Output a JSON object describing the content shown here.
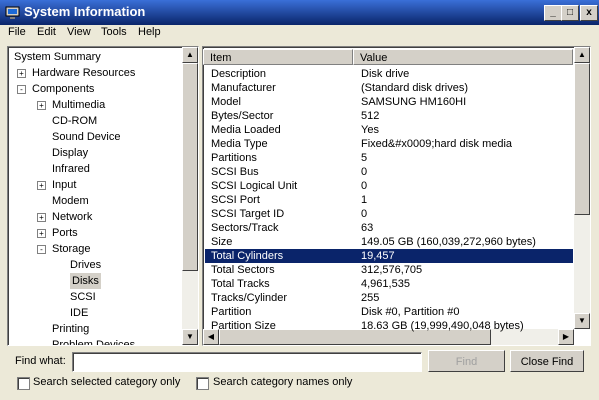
{
  "window": {
    "title": "System Information"
  },
  "title_buttons": {
    "minimize": "_",
    "maximize": "□",
    "close": "x"
  },
  "menu": {
    "file": "File",
    "edit": "Edit",
    "view": "View",
    "tools": "Tools",
    "help": "Help"
  },
  "tree": {
    "items": [
      {
        "label": "System Summary",
        "depth": 0,
        "expander": "none"
      },
      {
        "label": "Hardware Resources",
        "depth": 1,
        "expander": "+"
      },
      {
        "label": "Components",
        "depth": 1,
        "expander": "-"
      },
      {
        "label": "Multimedia",
        "depth": 2,
        "expander": "+"
      },
      {
        "label": "CD-ROM",
        "depth": 2,
        "expander": "none"
      },
      {
        "label": "Sound Device",
        "depth": 2,
        "expander": "none"
      },
      {
        "label": "Display",
        "depth": 2,
        "expander": "none"
      },
      {
        "label": "Infrared",
        "depth": 2,
        "expander": "none"
      },
      {
        "label": "Input",
        "depth": 2,
        "expander": "+"
      },
      {
        "label": "Modem",
        "depth": 2,
        "expander": "none"
      },
      {
        "label": "Network",
        "depth": 2,
        "expander": "+"
      },
      {
        "label": "Ports",
        "depth": 2,
        "expander": "+"
      },
      {
        "label": "Storage",
        "depth": 2,
        "expander": "-"
      },
      {
        "label": "Drives",
        "depth": 3,
        "expander": "none"
      },
      {
        "label": "Disks",
        "depth": 3,
        "expander": "none",
        "selected": true
      },
      {
        "label": "SCSI",
        "depth": 3,
        "expander": "none"
      },
      {
        "label": "IDE",
        "depth": 3,
        "expander": "none"
      },
      {
        "label": "Printing",
        "depth": 2,
        "expander": "none"
      },
      {
        "label": "Problem Devices",
        "depth": 2,
        "expander": "none"
      }
    ]
  },
  "list": {
    "headers": {
      "item": "Item",
      "value": "Value"
    },
    "rows": [
      {
        "item": "Description",
        "value": "Disk drive"
      },
      {
        "item": "Manufacturer",
        "value": "(Standard disk drives)"
      },
      {
        "item": "Model",
        "value": "SAMSUNG HM160HI"
      },
      {
        "item": "Bytes/Sector",
        "value": "512"
      },
      {
        "item": "Media Loaded",
        "value": "Yes"
      },
      {
        "item": "Media Type",
        "value": "Fixed&#x0009;hard disk media"
      },
      {
        "item": "Partitions",
        "value": "5"
      },
      {
        "item": "SCSI Bus",
        "value": "0"
      },
      {
        "item": "SCSI Logical Unit",
        "value": "0"
      },
      {
        "item": "SCSI Port",
        "value": "1"
      },
      {
        "item": "SCSI Target ID",
        "value": "0"
      },
      {
        "item": "Sectors/Track",
        "value": "63"
      },
      {
        "item": "Size",
        "value": "149.05 GB (160,039,272,960 bytes)"
      },
      {
        "item": "Total Cylinders",
        "value": "19,457",
        "highlighted": true
      },
      {
        "item": "Total Sectors",
        "value": "312,576,705"
      },
      {
        "item": "Total Tracks",
        "value": "4,961,535"
      },
      {
        "item": "Tracks/Cylinder",
        "value": "255"
      },
      {
        "item": "Partition",
        "value": "Disk #0, Partition #0"
      },
      {
        "item": "Partition Size",
        "value": "18.63 GB (19,999,490,048 bytes)"
      }
    ]
  },
  "find": {
    "label": "Find what:",
    "value": "",
    "find_button": "Find",
    "close_button": "Close Find",
    "cb_selected_category": "Search selected category only",
    "cb_category_names": "Search category names only"
  },
  "colors": {
    "selection": "#0a246a",
    "titlebar": "#0a246a",
    "face": "#ece9d8"
  }
}
